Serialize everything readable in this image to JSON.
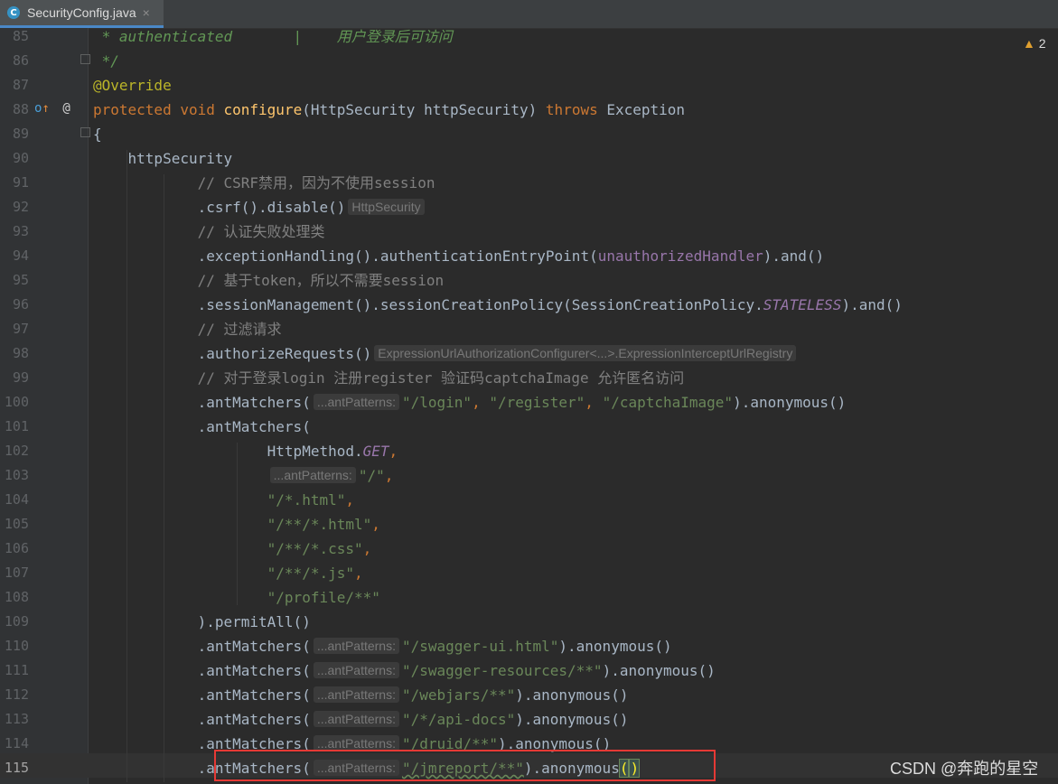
{
  "tab": {
    "icon": "java-class-icon",
    "label": "SecurityConfig.java",
    "close": "×"
  },
  "inspection": {
    "icon": "warning-icon",
    "count": "2"
  },
  "watermark": "CSDN @奔跑的星空",
  "lines": [
    {
      "n": "85",
      "parts": [
        {
          "t": " * authenticated       |    用户登录后可访问",
          "c": "doc"
        }
      ]
    },
    {
      "n": "86",
      "parts": [
        {
          "t": " */",
          "c": "doc"
        }
      ]
    },
    {
      "n": "87",
      "parts": [
        {
          "t": "@Override",
          "c": "ann"
        }
      ]
    },
    {
      "n": "88",
      "parts": [
        {
          "t": "protected void ",
          "c": "kw"
        },
        {
          "t": "configure",
          "c": "fn"
        },
        {
          "t": "(HttpSecurity httpSecurity) ",
          "c": ""
        },
        {
          "t": "throws",
          "c": "kw"
        },
        {
          "t": " Exception",
          "c": ""
        }
      ]
    },
    {
      "n": "89",
      "parts": [
        {
          "t": "{",
          "c": ""
        }
      ]
    },
    {
      "n": "90",
      "parts": [
        {
          "t": "    httpSecurity",
          "c": ""
        }
      ]
    },
    {
      "n": "91",
      "parts": [
        {
          "t": "            // CSRF禁用，因为不使用session",
          "c": "cm"
        }
      ]
    },
    {
      "n": "92",
      "parts": [
        {
          "t": "            .csrf().disable()",
          "c": ""
        },
        {
          "h": "HttpSecurity"
        }
      ]
    },
    {
      "n": "93",
      "parts": [
        {
          "t": "            // 认证失败处理类",
          "c": "cm"
        }
      ]
    },
    {
      "n": "94",
      "parts": [
        {
          "t": "            .exceptionHandling().authenticationEntryPoint(",
          "c": ""
        },
        {
          "t": "unauthorizedHandler",
          "c": "field"
        },
        {
          "t": ").and()",
          "c": ""
        }
      ]
    },
    {
      "n": "95",
      "parts": [
        {
          "t": "            // 基于token，所以不需要session",
          "c": "cm"
        }
      ]
    },
    {
      "n": "96",
      "parts": [
        {
          "t": "            .sessionManagement().sessionCreationPolicy(SessionCreationPolicy.",
          "c": ""
        },
        {
          "t": "STATELESS",
          "c": "static"
        },
        {
          "t": ").and()",
          "c": ""
        }
      ]
    },
    {
      "n": "97",
      "parts": [
        {
          "t": "            // 过滤请求",
          "c": "cm"
        }
      ]
    },
    {
      "n": "98",
      "parts": [
        {
          "t": "            .authorizeRequests()",
          "c": ""
        },
        {
          "h": "ExpressionUrlAuthorizationConfigurer<...>.ExpressionInterceptUrlRegistry"
        }
      ]
    },
    {
      "n": "99",
      "parts": [
        {
          "t": "            // 对于登录login 注册register 验证码captchaImage 允许匿名访问",
          "c": "cm"
        }
      ]
    },
    {
      "n": "100",
      "parts": [
        {
          "t": "            .antMatchers(",
          "c": ""
        },
        {
          "h": "...antPatterns:"
        },
        {
          "t": "\"/login\"",
          "c": "str"
        },
        {
          "t": ", ",
          "c": "kw"
        },
        {
          "t": "\"/register\"",
          "c": "str"
        },
        {
          "t": ", ",
          "c": "kw"
        },
        {
          "t": "\"/captchaImage\"",
          "c": "str"
        },
        {
          "t": ").anonymous()",
          "c": ""
        }
      ]
    },
    {
      "n": "101",
      "parts": [
        {
          "t": "            .antMatchers(",
          "c": ""
        }
      ]
    },
    {
      "n": "102",
      "parts": [
        {
          "t": "                    HttpMethod.",
          "c": ""
        },
        {
          "t": "GET",
          "c": "static"
        },
        {
          "t": ",",
          "c": "kw"
        }
      ]
    },
    {
      "n": "103",
      "parts": [
        {
          "t": "                    ",
          "c": ""
        },
        {
          "h": "...antPatterns:"
        },
        {
          "t": "\"/\"",
          "c": "str"
        },
        {
          "t": ",",
          "c": "kw"
        }
      ]
    },
    {
      "n": "104",
      "parts": [
        {
          "t": "                    \"/*.html\"",
          "c": "str"
        },
        {
          "t": ",",
          "c": "kw"
        }
      ]
    },
    {
      "n": "105",
      "parts": [
        {
          "t": "                    \"/**/*.html\"",
          "c": "str"
        },
        {
          "t": ",",
          "c": "kw"
        }
      ]
    },
    {
      "n": "106",
      "parts": [
        {
          "t": "                    \"/**/*.css\"",
          "c": "str"
        },
        {
          "t": ",",
          "c": "kw"
        }
      ]
    },
    {
      "n": "107",
      "parts": [
        {
          "t": "                    \"/**/*.js\"",
          "c": "str"
        },
        {
          "t": ",",
          "c": "kw"
        }
      ]
    },
    {
      "n": "108",
      "parts": [
        {
          "t": "                    \"/profile/**\"",
          "c": "str"
        }
      ]
    },
    {
      "n": "109",
      "parts": [
        {
          "t": "            ).permitAll()",
          "c": ""
        }
      ]
    },
    {
      "n": "110",
      "parts": [
        {
          "t": "            .antMatchers(",
          "c": ""
        },
        {
          "h": "...antPatterns:"
        },
        {
          "t": "\"/swagger-ui.html\"",
          "c": "str"
        },
        {
          "t": ").anonymous()",
          "c": ""
        }
      ]
    },
    {
      "n": "111",
      "parts": [
        {
          "t": "            .antMatchers(",
          "c": ""
        },
        {
          "h": "...antPatterns:"
        },
        {
          "t": "\"/swagger-resources/**\"",
          "c": "str"
        },
        {
          "t": ").anonymous()",
          "c": ""
        }
      ]
    },
    {
      "n": "112",
      "parts": [
        {
          "t": "            .antMatchers(",
          "c": ""
        },
        {
          "h": "...antPatterns:"
        },
        {
          "t": "\"/webjars/**\"",
          "c": "str"
        },
        {
          "t": ").anonymous()",
          "c": ""
        }
      ]
    },
    {
      "n": "113",
      "parts": [
        {
          "t": "            .antMatchers(",
          "c": ""
        },
        {
          "h": "...antPatterns:"
        },
        {
          "t": "\"/*/api-docs\"",
          "c": "str"
        },
        {
          "t": ").anonymous()",
          "c": ""
        }
      ]
    },
    {
      "n": "114",
      "parts": [
        {
          "t": "            .antMatchers(",
          "c": ""
        },
        {
          "h": "...antPatterns:"
        },
        {
          "t": "\"/druid/**\"",
          "c": "str"
        },
        {
          "t": ").anonymous()",
          "c": ""
        }
      ]
    },
    {
      "n": "115",
      "cur": true,
      "parts": [
        {
          "t": "            .antMatchers(",
          "c": ""
        },
        {
          "h": "...antPatterns:"
        },
        {
          "t": "\"/jmreport/**\"",
          "c": "str"
        },
        {
          "t": ").anonymous",
          "c": ""
        },
        {
          "t": "(",
          "c": "brace"
        },
        {
          "caret": true
        },
        {
          "t": ")",
          "c": "brace"
        }
      ]
    }
  ]
}
